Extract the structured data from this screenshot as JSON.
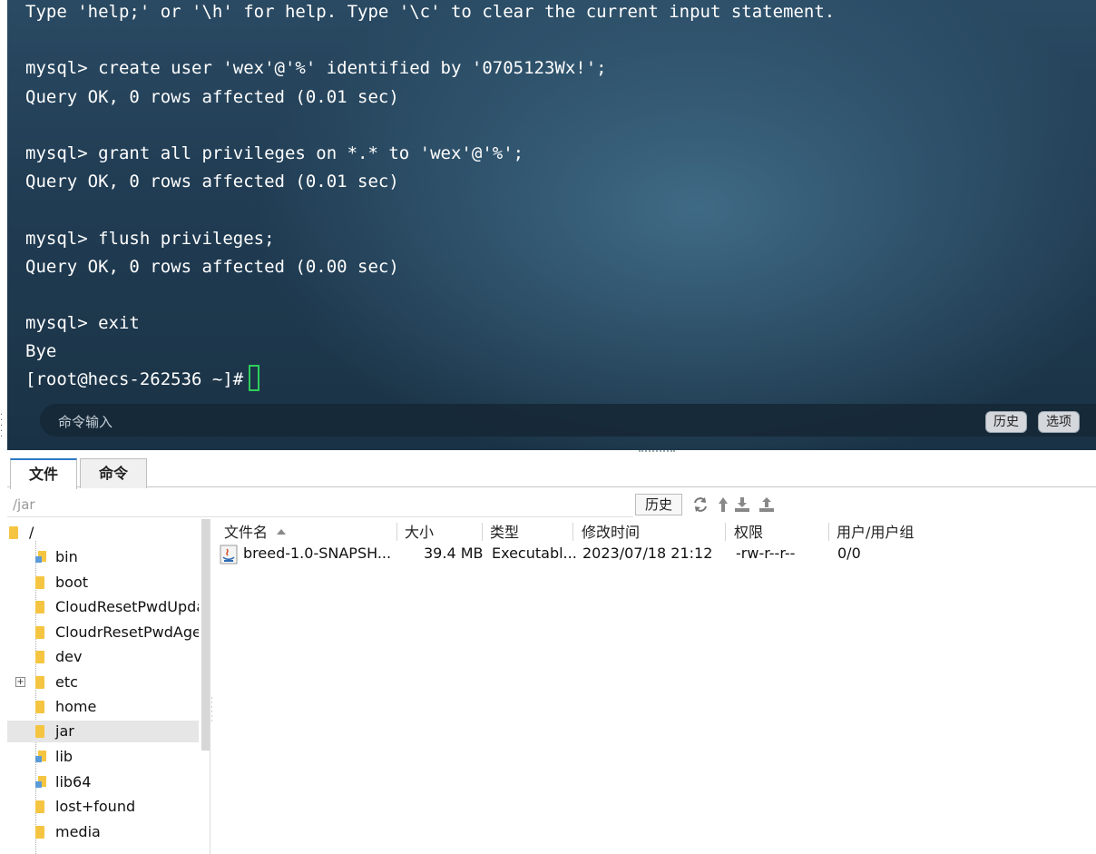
{
  "terminal": {
    "lines": [
      "Type 'help;' or '\\h' for help. Type '\\c' to clear the current input statement.",
      "",
      "mysql> create user 'wex'@'%' identified by '0705123Wx!';",
      "Query OK, 0 rows affected (0.01 sec)",
      "",
      "mysql> grant all privileges on *.* to 'wex'@'%';",
      "Query OK, 0 rows affected (0.01 sec)",
      "",
      "mysql> flush privileges;",
      "Query OK, 0 rows affected (0.00 sec)",
      "",
      "mysql> exit",
      "Bye"
    ],
    "prompt": "[root@hecs-262536 ~]#",
    "command_bar": {
      "placeholder": "命令输入",
      "history_label": "历史",
      "options_label": "选项"
    },
    "cursor_color": "#2ecf5a"
  },
  "tabs": [
    {
      "label": "文件",
      "active": true
    },
    {
      "label": "命令",
      "active": false
    }
  ],
  "path_bar": {
    "path": "/jar",
    "history_label": "历史",
    "icons": [
      "refresh-icon",
      "up-directory-icon",
      "download-icon",
      "upload-icon"
    ]
  },
  "tree": {
    "root": "/",
    "items": [
      {
        "label": "bin",
        "kind": "link"
      },
      {
        "label": "boot",
        "kind": "folder"
      },
      {
        "label": "CloudResetPwdUpda",
        "kind": "folder"
      },
      {
        "label": "CloudrResetPwdAge",
        "kind": "folder"
      },
      {
        "label": "dev",
        "kind": "folder"
      },
      {
        "label": "etc",
        "kind": "folder",
        "expandable": true
      },
      {
        "label": "home",
        "kind": "folder"
      },
      {
        "label": "jar",
        "kind": "folder",
        "selected": true
      },
      {
        "label": "lib",
        "kind": "link"
      },
      {
        "label": "lib64",
        "kind": "link"
      },
      {
        "label": "lost+found",
        "kind": "folder"
      },
      {
        "label": "media",
        "kind": "folder"
      }
    ]
  },
  "file_list": {
    "columns": [
      "文件名",
      "大小",
      "类型",
      "修改时间",
      "权限",
      "用户/用户组"
    ],
    "rows": [
      {
        "name": "breed-1.0-SNAPSH...",
        "size": "39.4 MB",
        "type": "Executabl...",
        "modified": "2023/07/18 21:12",
        "permissions": "-rw-r--r--",
        "owner": "0/0",
        "icon": "java-jar-icon"
      }
    ]
  }
}
